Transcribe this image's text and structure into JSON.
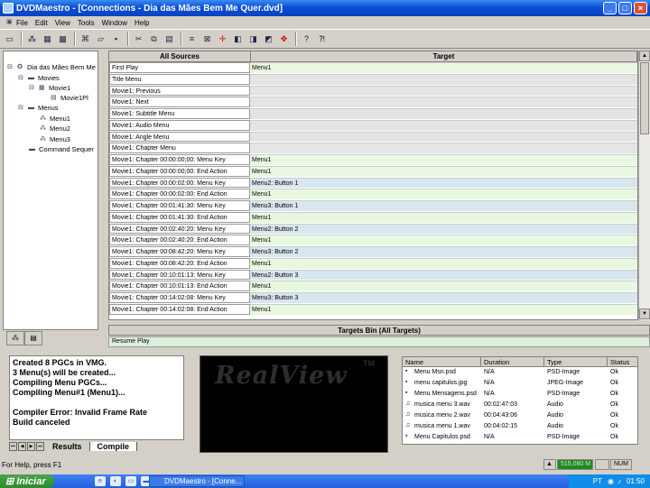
{
  "window": {
    "title": "DVDMaestro - [Connections - Dia das Mães Bem Me Quer.dvd]",
    "min_glyph": "_",
    "max_glyph": "□",
    "close_glyph": "×"
  },
  "menubar": [
    "File",
    "Edit",
    "View",
    "Tools",
    "Window",
    "Help"
  ],
  "tree": {
    "root": "Dia das Mães Bem Me",
    "movies": "Movies",
    "movie1": "Movie1",
    "movie1play": "Movie1Pl",
    "menus": "Menus",
    "menu1": "Menu1",
    "menu2": "Menu2",
    "menu3": "Menu3",
    "command": "Command Sequer"
  },
  "grid": {
    "col_sources": "All Sources",
    "col_target": "Target",
    "rows": [
      {
        "src": "First Play",
        "tgt": "Menu1",
        "color": "#e8f8e0"
      },
      {
        "src": "Title Menu",
        "tgt": "",
        "color": "#e4e4e4"
      },
      {
        "src": "Movie1: Previous",
        "tgt": "",
        "color": "#e4e4e4"
      },
      {
        "src": "Movie1: Next",
        "tgt": "",
        "color": "#e4e4e4"
      },
      {
        "src": "Movie1: Subtitle Menu",
        "tgt": "",
        "color": "#e4e4e4"
      },
      {
        "src": "Movie1: Audio Menu",
        "tgt": "",
        "color": "#e4e4e4"
      },
      {
        "src": "Movie1: Angle Menu",
        "tgt": "",
        "color": "#e4e4e4"
      },
      {
        "src": "Movie1: Chapter Menu",
        "tgt": "",
        "color": "#e4e4e4"
      },
      {
        "src": "Movie1: Chapter 00:00:00;00: Menu Key",
        "tgt": "Menu1",
        "color": "#e8f8e0"
      },
      {
        "src": "Movie1: Chapter 00:00:00;00: End Action",
        "tgt": "Menu1",
        "color": "#e8f8e0"
      },
      {
        "src": "Movie1: Chapter 00:00:02:00: Menu Key",
        "tgt": "Menu2: Button 1",
        "color": "#d8e6ee"
      },
      {
        "src": "Movie1: Chapter 00:00:02:00: End Action",
        "tgt": "Menu1",
        "color": "#e8f8e0"
      },
      {
        "src": "Movie1: Chapter 00:01:41:30: Menu Key",
        "tgt": "Menu3: Button 1",
        "color": "#d8e6ee"
      },
      {
        "src": "Movie1: Chapter 00:01:41:30: End Action",
        "tgt": "Menu1",
        "color": "#e8f8e0"
      },
      {
        "src": "Movie1: Chapter 00:02:40:20: Menu Key",
        "tgt": "Menu2: Button 2",
        "color": "#d8e6ee"
      },
      {
        "src": "Movie1: Chapter 00:02:40:20: End Action",
        "tgt": "Menu1",
        "color": "#e8f8e0"
      },
      {
        "src": "Movie1: Chapter 00:08:42:20: Menu Key",
        "tgt": "Menu3: Button 2",
        "color": "#d8e6ee"
      },
      {
        "src": "Movie1: Chapter 00:08:42:20: End Action",
        "tgt": "Menu1",
        "color": "#e8f8e0"
      },
      {
        "src": "Movie1: Chapter 00:10:01:13: Menu Key",
        "tgt": "Menu2: Button 3",
        "color": "#d8e6ee"
      },
      {
        "src": "Movie1: Chapter 00:10:01:13: End Action",
        "tgt": "Menu1",
        "color": "#e8f8e0"
      },
      {
        "src": "Movie1: Chapter 00:14:02:08: Menu Key",
        "tgt": "Menu3: Button 3",
        "color": "#d8e6ee"
      },
      {
        "src": "Movie1: Chapter 00:14:02:08: End Action",
        "tgt": "Menu1",
        "color": "#e8f8e0"
      }
    ]
  },
  "bin": {
    "title": "Targets Bin (All Targets)",
    "item": "Resume Play"
  },
  "log": {
    "lines": [
      "Created 8 PGCs in VMG.",
      "3 Menu(s) will be created...",
      "Compiling Menu PGCs...",
      "Compiling Menu#1 (Menu1)...",
      "",
      "Compiler Error: Invalid Frame Rate",
      "Build canceled"
    ],
    "tab_results": "Results",
    "tab_compile": "Compile"
  },
  "preview": {
    "logo": "RealView",
    "tm": "TM"
  },
  "assets": {
    "headers": {
      "name": "Name",
      "duration": "Duration",
      "type": "Type",
      "status": "Status"
    },
    "rows": [
      {
        "name": "Menu Msn.psd",
        "duration": "N/A",
        "type": "PSD-Image",
        "status": "Ok",
        "icon": "image"
      },
      {
        "name": "menu capitulos.jpg",
        "duration": "N/A",
        "type": "JPEG-Image",
        "status": "Ok",
        "icon": "image"
      },
      {
        "name": "Menu Mensagens.psd",
        "duration": "N/A",
        "type": "PSD-Image",
        "status": "Ok",
        "icon": "image"
      },
      {
        "name": "musica menu 3.wav",
        "duration": "00:02:47:03",
        "type": "Audio",
        "status": "Ok",
        "icon": "audio"
      },
      {
        "name": "musica menu 2.wav",
        "duration": "00:04:43:06",
        "type": "Audio",
        "status": "Ok",
        "icon": "audio"
      },
      {
        "name": "musica menu 1.wav",
        "duration": "00:04:02:15",
        "type": "Audio",
        "status": "Ok",
        "icon": "audio"
      },
      {
        "name": "Menu Capitulos.psd",
        "duration": "N/A",
        "type": "PSD-Image",
        "status": "Ok",
        "icon": "image"
      }
    ]
  },
  "statusbar": {
    "help": "For Help, press F1",
    "memory": "515,080 M",
    "num": "NUM"
  },
  "taskbar": {
    "start": "Iniciar",
    "task": "DVDMaestro - [Conne...",
    "lang": "PT",
    "clock": "01:50"
  },
  "colors": {
    "title_blue": "#0a4fd8",
    "row_green": "#e8f8e0",
    "row_blue": "#d8e6ee",
    "row_gray": "#e4e4e4"
  }
}
